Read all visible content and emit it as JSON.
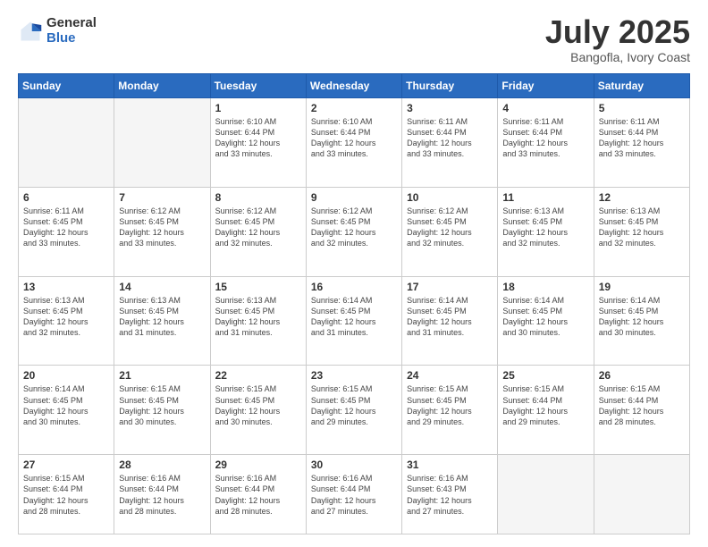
{
  "logo": {
    "general": "General",
    "blue": "Blue"
  },
  "header": {
    "month": "July 2025",
    "location": "Bangofla, Ivory Coast"
  },
  "days_of_week": [
    "Sunday",
    "Monday",
    "Tuesday",
    "Wednesday",
    "Thursday",
    "Friday",
    "Saturday"
  ],
  "weeks": [
    [
      {
        "day": "",
        "info": ""
      },
      {
        "day": "",
        "info": ""
      },
      {
        "day": "1",
        "info": "Sunrise: 6:10 AM\nSunset: 6:44 PM\nDaylight: 12 hours\nand 33 minutes."
      },
      {
        "day": "2",
        "info": "Sunrise: 6:10 AM\nSunset: 6:44 PM\nDaylight: 12 hours\nand 33 minutes."
      },
      {
        "day": "3",
        "info": "Sunrise: 6:11 AM\nSunset: 6:44 PM\nDaylight: 12 hours\nand 33 minutes."
      },
      {
        "day": "4",
        "info": "Sunrise: 6:11 AM\nSunset: 6:44 PM\nDaylight: 12 hours\nand 33 minutes."
      },
      {
        "day": "5",
        "info": "Sunrise: 6:11 AM\nSunset: 6:44 PM\nDaylight: 12 hours\nand 33 minutes."
      }
    ],
    [
      {
        "day": "6",
        "info": "Sunrise: 6:11 AM\nSunset: 6:45 PM\nDaylight: 12 hours\nand 33 minutes."
      },
      {
        "day": "7",
        "info": "Sunrise: 6:12 AM\nSunset: 6:45 PM\nDaylight: 12 hours\nand 33 minutes."
      },
      {
        "day": "8",
        "info": "Sunrise: 6:12 AM\nSunset: 6:45 PM\nDaylight: 12 hours\nand 32 minutes."
      },
      {
        "day": "9",
        "info": "Sunrise: 6:12 AM\nSunset: 6:45 PM\nDaylight: 12 hours\nand 32 minutes."
      },
      {
        "day": "10",
        "info": "Sunrise: 6:12 AM\nSunset: 6:45 PM\nDaylight: 12 hours\nand 32 minutes."
      },
      {
        "day": "11",
        "info": "Sunrise: 6:13 AM\nSunset: 6:45 PM\nDaylight: 12 hours\nand 32 minutes."
      },
      {
        "day": "12",
        "info": "Sunrise: 6:13 AM\nSunset: 6:45 PM\nDaylight: 12 hours\nand 32 minutes."
      }
    ],
    [
      {
        "day": "13",
        "info": "Sunrise: 6:13 AM\nSunset: 6:45 PM\nDaylight: 12 hours\nand 32 minutes."
      },
      {
        "day": "14",
        "info": "Sunrise: 6:13 AM\nSunset: 6:45 PM\nDaylight: 12 hours\nand 31 minutes."
      },
      {
        "day": "15",
        "info": "Sunrise: 6:13 AM\nSunset: 6:45 PM\nDaylight: 12 hours\nand 31 minutes."
      },
      {
        "day": "16",
        "info": "Sunrise: 6:14 AM\nSunset: 6:45 PM\nDaylight: 12 hours\nand 31 minutes."
      },
      {
        "day": "17",
        "info": "Sunrise: 6:14 AM\nSunset: 6:45 PM\nDaylight: 12 hours\nand 31 minutes."
      },
      {
        "day": "18",
        "info": "Sunrise: 6:14 AM\nSunset: 6:45 PM\nDaylight: 12 hours\nand 30 minutes."
      },
      {
        "day": "19",
        "info": "Sunrise: 6:14 AM\nSunset: 6:45 PM\nDaylight: 12 hours\nand 30 minutes."
      }
    ],
    [
      {
        "day": "20",
        "info": "Sunrise: 6:14 AM\nSunset: 6:45 PM\nDaylight: 12 hours\nand 30 minutes."
      },
      {
        "day": "21",
        "info": "Sunrise: 6:15 AM\nSunset: 6:45 PM\nDaylight: 12 hours\nand 30 minutes."
      },
      {
        "day": "22",
        "info": "Sunrise: 6:15 AM\nSunset: 6:45 PM\nDaylight: 12 hours\nand 30 minutes."
      },
      {
        "day": "23",
        "info": "Sunrise: 6:15 AM\nSunset: 6:45 PM\nDaylight: 12 hours\nand 29 minutes."
      },
      {
        "day": "24",
        "info": "Sunrise: 6:15 AM\nSunset: 6:45 PM\nDaylight: 12 hours\nand 29 minutes."
      },
      {
        "day": "25",
        "info": "Sunrise: 6:15 AM\nSunset: 6:44 PM\nDaylight: 12 hours\nand 29 minutes."
      },
      {
        "day": "26",
        "info": "Sunrise: 6:15 AM\nSunset: 6:44 PM\nDaylight: 12 hours\nand 28 minutes."
      }
    ],
    [
      {
        "day": "27",
        "info": "Sunrise: 6:15 AM\nSunset: 6:44 PM\nDaylight: 12 hours\nand 28 minutes."
      },
      {
        "day": "28",
        "info": "Sunrise: 6:16 AM\nSunset: 6:44 PM\nDaylight: 12 hours\nand 28 minutes."
      },
      {
        "day": "29",
        "info": "Sunrise: 6:16 AM\nSunset: 6:44 PM\nDaylight: 12 hours\nand 28 minutes."
      },
      {
        "day": "30",
        "info": "Sunrise: 6:16 AM\nSunset: 6:44 PM\nDaylight: 12 hours\nand 27 minutes."
      },
      {
        "day": "31",
        "info": "Sunrise: 6:16 AM\nSunset: 6:43 PM\nDaylight: 12 hours\nand 27 minutes."
      },
      {
        "day": "",
        "info": ""
      },
      {
        "day": "",
        "info": ""
      }
    ]
  ]
}
